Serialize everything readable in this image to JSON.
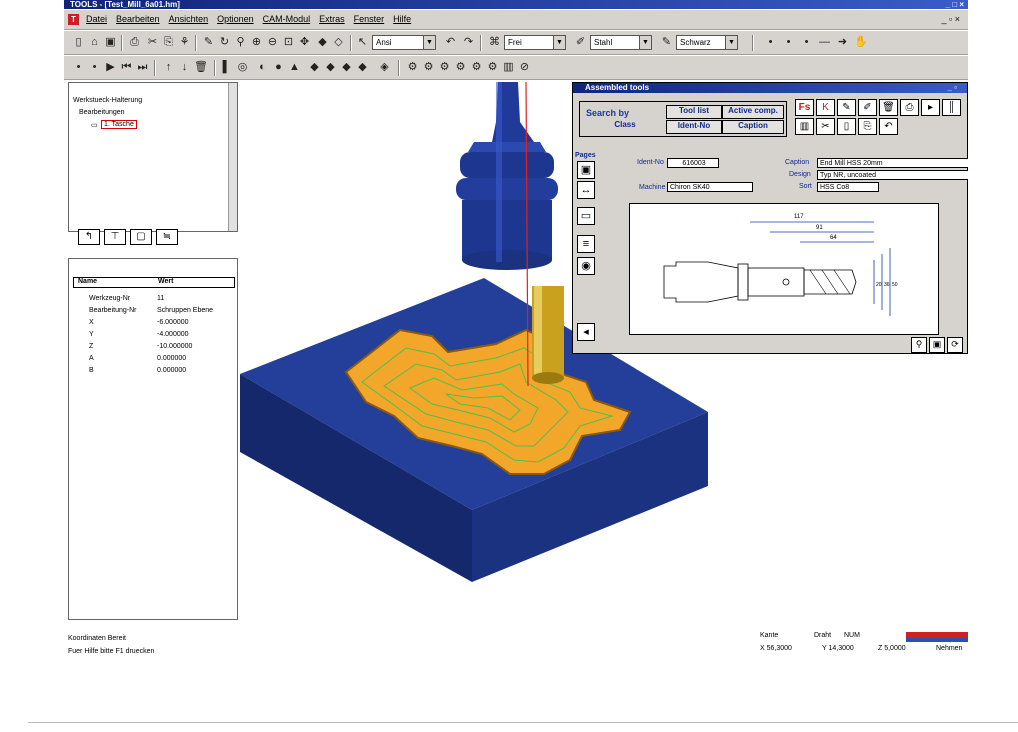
{
  "window": {
    "title": "TOOLS - [Test_Mill_6a01.hm]",
    "controls": "_ □ ×"
  },
  "menu": {
    "items": [
      "Datei",
      "Bearbeiten",
      "Ansichten",
      "Optionen",
      "CAM-Modul",
      "Extras",
      "Fenster",
      "Hilfe"
    ],
    "mdi_controls": "_ ▫ ×"
  },
  "toolbar1": {
    "combo_view": "Ansi",
    "combo_mode": "Frei",
    "combo_material": "Stahl",
    "combo_color": "Schwarz"
  },
  "tree": {
    "items": [
      "Werkstueck-Halterung",
      "Bearbeitungen",
      "1. Tasche"
    ]
  },
  "properties": {
    "headers": [
      "Name",
      "Wert"
    ],
    "rows": [
      {
        "name": "Werkzeug-Nr",
        "value": "11"
      },
      {
        "name": "Bearbeitung-Nr",
        "value": "Schruppen Ebene"
      },
      {
        "name": "X",
        "value": "-6.000000"
      },
      {
        "name": "Y",
        "value": "-4.000000"
      },
      {
        "name": "Z",
        "value": "-10.000000"
      },
      {
        "name": "A",
        "value": "0.000000"
      },
      {
        "name": "B",
        "value": "0.000000"
      }
    ]
  },
  "status": {
    "left_top": "Koordinaten Bereit",
    "left_bottom": "Fuer Hilfe bitte F1 druecken",
    "right_top_1": "Kante",
    "right_top_2": "Draht",
    "right_top_3": "NUM",
    "right_bottom_1": "X 56,3000",
    "right_bottom_2": "Y 14,3000",
    "right_bottom_3": "Z 5,0000",
    "right_bottom_4": "Nehmen"
  },
  "dialog": {
    "title": "Assembled tools",
    "search_by": "Search by",
    "tool_list": "Tool list",
    "active_comp": "Active comp.",
    "class": "Class",
    "ident_no_btn": "Ident-No",
    "caption_btn": "Caption",
    "pages_label": "Pages",
    "ident_no_label": "Ident-No",
    "ident_no_value": "616003",
    "caption_label": "Caption",
    "caption_value": "End Mill HSS 20mm",
    "design_label": "Design",
    "design_value": "Typ NR, uncoated",
    "machine_label": "Machine",
    "machine_value": "Chiron SK40",
    "sort_label": "Sort",
    "sort_value": "HSS Co8",
    "dim_117": "117",
    "dim_91": "91",
    "dim_64": "64",
    "dim_20": "20",
    "dim_36": "36",
    "dim_50": "50"
  },
  "colors": {
    "block": "#1a3a8a",
    "pocket": "#f0a020",
    "toolpath": "#3cbf3c",
    "shank": "#c8a020"
  }
}
